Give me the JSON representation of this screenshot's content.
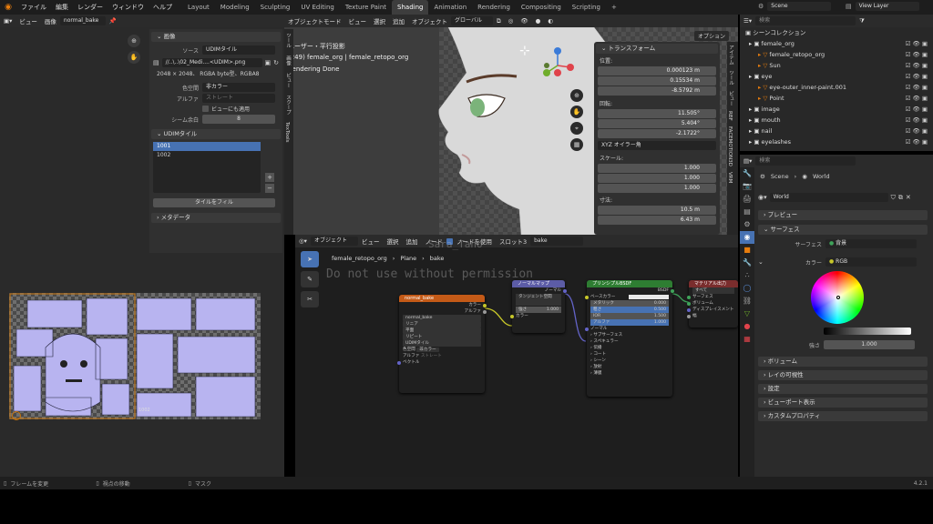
{
  "topbar": {
    "menu": [
      "ファイル",
      "編集",
      "レンダー",
      "ウィンドウ",
      "ヘルプ"
    ],
    "tabs": [
      "Layout",
      "Modeling",
      "Sculpting",
      "UV Editing",
      "Texture Paint",
      "Shading",
      "Animation",
      "Rendering",
      "Compositing",
      "Scripting"
    ],
    "active_tab": "Shading",
    "scene": "Scene",
    "view_layer": "View Layer",
    "search_placeholder": "検索"
  },
  "image_editor": {
    "header": [
      "ビュー",
      "画像"
    ],
    "image_name": "normal_bake",
    "section_image": "画像",
    "source_label": "ソース",
    "source_value": "UDIMタイル",
    "filepath": "//..\\..\\02_Medi....<UDIM>.png",
    "info": "2048 × 2048、 RGBA byte型、RGBA8",
    "colorspace_label": "色空間",
    "colorspace_value": "非カラー",
    "alpha_label": "アルファ",
    "alpha_value": "ストレート",
    "view_checkbox": "ビューにも適用",
    "seam_label": "シーム余白",
    "seam_value": "8",
    "udim_section": "UDIMタイル",
    "tiles": [
      "1001",
      "1002"
    ],
    "fill_button": "タイルをフィル",
    "metadata": "メタデータ",
    "tile_label_1002": "1002",
    "footer": [
      "フレームを変更",
      "視点の移動",
      "マスク"
    ]
  },
  "viewport": {
    "header": [
      "オブジェクトモード",
      "ビュー",
      "選択",
      "追加",
      "オブジェクト"
    ],
    "orientation": "グローバル",
    "view_name": "ユーザー・平行投影",
    "object_info": "(249) female_org | female_retopo_org",
    "status": "Rendering Done",
    "options": "オプション",
    "side_tabs": [
      "アイテム",
      "ツール",
      "ビュー",
      "RBF",
      "FACEMOTION3D",
      "VRM"
    ],
    "left_tabs": [
      "ツール",
      "画像",
      "ビュー",
      "スクープ",
      "TexTools"
    ]
  },
  "transform": {
    "title": "トランスフォーム",
    "location_label": "位置:",
    "location": [
      "0.000123 m",
      "0.15534 m",
      "-8.5792 m"
    ],
    "rotation_label": "回転:",
    "rotation": [
      "11.505°",
      "5.404°",
      "-2.1722°"
    ],
    "rotation_mode": "XYZ オイラー角",
    "scale_label": "スケール:",
    "scale": [
      "1.000",
      "1.000",
      "1.000"
    ],
    "dimensions_label": "寸法:",
    "dimensions": [
      "10.5 m",
      "6.43 m"
    ]
  },
  "node_editor": {
    "header": [
      "オブジェクト",
      "ビュー",
      "選択",
      "追加",
      "ノード"
    ],
    "use_nodes": "ノードを使用",
    "slot": "スロット3",
    "material": "bake",
    "breadcrumb": [
      "female_retopo_org",
      "Plane",
      "bake"
    ],
    "watermark_name": "Sara_Tano",
    "watermark_text": "Do not use without permission",
    "nodes": {
      "image": {
        "title": "normal_bake",
        "outputs": [
          "カラー",
          "アルファ"
        ],
        "image": "normal_bake",
        "rows": [
          "リニア",
          "平面",
          "リピート",
          "UDIMタイル"
        ],
        "colorspace_label": "色空間",
        "colorspace": "非カラー",
        "alpha_label": "アルファ",
        "alpha": "ストレート",
        "vector": "ベクトル"
      },
      "normalmap": {
        "title": "ノーマルマップ",
        "out": "ノーマル",
        "space": "タンジェント空間",
        "strength_label": "強さ",
        "strength": "1.000",
        "color": "カラー"
      },
      "bsdf": {
        "title": "プリンシプルBSDF",
        "out": "BSDF",
        "rows": [
          [
            "ベースカラー",
            ""
          ],
          [
            "メタリック",
            "0.000"
          ],
          [
            "粗さ",
            "0.500"
          ],
          [
            "IOR",
            "1.500"
          ],
          [
            "アルファ",
            "1.000"
          ]
        ],
        "subs": [
          "ノーマル",
          "サブサーフェス",
          "スペキュラー",
          "伝播",
          "コート",
          "シーン",
          "放射",
          "薄膜"
        ]
      },
      "output": {
        "title": "マテリアル出力",
        "target": "すべて",
        "inputs": [
          "サーフェス",
          "ボリューム",
          "ディスプレイスメント",
          "幅"
        ]
      }
    }
  },
  "outliner": {
    "title": "シーンコレクション",
    "items": [
      {
        "name": "female_org",
        "depth": 0
      },
      {
        "name": "female_retopo_org",
        "depth": 1
      },
      {
        "name": "Sun",
        "depth": 1
      },
      {
        "name": "eye",
        "depth": 0
      },
      {
        "name": "eye-outer_inner-paint.001",
        "depth": 1
      },
      {
        "name": "Point",
        "depth": 1
      },
      {
        "name": "image",
        "depth": 0
      },
      {
        "name": "mouth",
        "depth": 0
      },
      {
        "name": "nail",
        "depth": 0
      },
      {
        "name": "eyelashes",
        "depth": 0
      }
    ]
  },
  "properties": {
    "breadcrumb": [
      "Scene",
      "World"
    ],
    "world_name": "World",
    "sections": {
      "preview": "プレビュー",
      "surface": "サーフェス",
      "surface_label": "サーフェス",
      "surface_value": "背景",
      "color_label": "カラー",
      "color_mode": "RGB",
      "strength_label": "強さ",
      "strength": "1.000",
      "volume": "ボリューム",
      "ray": "レイの可視性",
      "settings": "設定",
      "viewport": "ビューポート表示",
      "custom": "カスタムプロパティ"
    },
    "version": "4.2.1"
  },
  "colors": {
    "accent": "#4772b3",
    "image_node": "#c45a17",
    "shader_node": "#2e7d32",
    "vector_node": "#5c5ca6",
    "output_node": "#7a2d2d"
  }
}
